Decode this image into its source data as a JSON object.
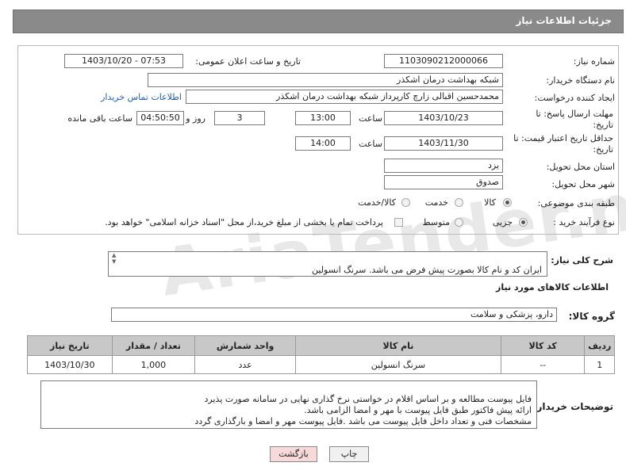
{
  "panel": {
    "title": "جزئیات اطلاعات نیاز"
  },
  "form": {
    "need_number_label": "شماره نیاز:",
    "need_number": "1103090212000066",
    "announce_label": "تاریخ و ساعت اعلان عمومی:",
    "announce_value": "1403/10/20 - 07:53",
    "buyer_org_label": "نام دستگاه خریدار:",
    "buyer_org": "شبکه بهداشت درمان اشکذر",
    "creator_label": "ایجاد کننده درخواست:",
    "creator": "محمدحسین اقبالی زارچ کارپرداز شبکه بهداشت درمان اشکذر",
    "contact_link": "اطلاعات تماس خریدار",
    "deadline_label": "مهلت ارسال پاسخ: تا تاریخ:",
    "deadline_date": "1403/10/23",
    "time_label": "ساعت",
    "deadline_time": "13:00",
    "days_value": "3",
    "days_label": "روز و",
    "remaining_value": "04:50:50",
    "remaining_label": "ساعت باقی مانده",
    "validity_label": "حداقل تاریخ اعتبار قیمت: تا تاریخ:",
    "validity_date": "1403/11/30",
    "validity_time": "14:00",
    "province_label": "استان محل تحویل:",
    "province": "یزد",
    "city_label": "شهر محل تحویل:",
    "city": "صدوق",
    "category_label": "طبقه بندی موضوعی:",
    "category_options": [
      "کالا",
      "خدمت",
      "کالا/خدمت"
    ],
    "purchase_type_label": "نوع فرآیند خرید :",
    "purchase_options": [
      "جزیی",
      "متوسط"
    ],
    "payment_note": "پرداخت تمام یا بخشی از مبلغ خرید،از محل \"اسناد خزانه اسلامی\" خواهد بود."
  },
  "description": {
    "label": "شرح کلی نیاز:",
    "text": "ایران کد و نام کالا بصورت پیش فرض می باشد. سرنگ انسولین\nارائه پیش فاکتور طبق فایل پیوست با مهر و امضا الزامی می باشد."
  },
  "goods_info": {
    "title": "اطلاعات کالاهای مورد نیاز",
    "group_label": "گروه کالا:",
    "group_value": "دارو، پزشکی و سلامت"
  },
  "table": {
    "headers": [
      "ردیف",
      "کد کالا",
      "نام کالا",
      "واحد شمارش",
      "تعداد / مقدار",
      "تاریخ نیاز"
    ],
    "rows": [
      {
        "row": "1",
        "code": "--",
        "name": "سرنگ انسولین",
        "unit": "عدد",
        "qty": "1,000",
        "date": "1403/10/30"
      }
    ]
  },
  "buyer_notes": {
    "label": "توضیحات خریدار:",
    "text": "فایل پیوست مطالعه و بر اساس اقلام در خواستی نرخ گذاری نهایی در سامانه صورت پذیرد\nارائه پیش فاکتور طبق فایل پیوست با مهر و امضا الزامی باشد.\nمشخصات فنی و تعداد داخل فایل پیوست می باشد .فایل پیوست مهر و امضا و بارگذاری گردد"
  },
  "buttons": {
    "print": "چاپ",
    "back": "بازگشت"
  },
  "watermark": "AriaTender.neT",
  "colors": {
    "header_bg": "#8a8a8a",
    "link": "#1f5fb0",
    "back_button_bg": "#f7d9d9"
  }
}
